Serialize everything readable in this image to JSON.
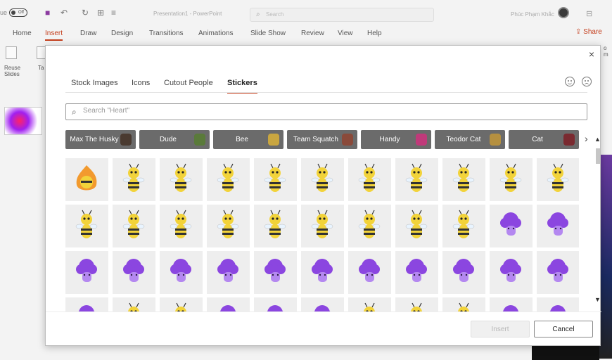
{
  "titlebar": {
    "autosave_label": "ue",
    "autosave_state": "Off",
    "document_title": "Presentation1 - PowerPoint",
    "search_placeholder": "Search",
    "user_name": "Phúc Phạm Khắc"
  },
  "ribbon": {
    "tabs": [
      "Home",
      "Insert",
      "Draw",
      "Design",
      "Transitions",
      "Animations",
      "Slide Show",
      "Review",
      "View",
      "Help"
    ],
    "active_tab": "Insert",
    "share_label": "Share",
    "reuse_label_1": "Reuse",
    "reuse_label_2": "Slides",
    "partial_group_label": "Ta",
    "partial_right_label_1": "ο",
    "partial_right_label_2": "m"
  },
  "dialog": {
    "close_symbol": "×",
    "tabs": [
      {
        "label": "Stock Images"
      },
      {
        "label": "Icons"
      },
      {
        "label": "Cutout People"
      },
      {
        "label": "Stickers"
      }
    ],
    "active_tab": "Stickers",
    "search": {
      "placeholder": "Search \"Heart\""
    },
    "categories": [
      "Max The Husky",
      "Dude",
      "Bee",
      "Team Squatch",
      "Handy",
      "Teodor Cat",
      "Cat"
    ],
    "category_colors": [
      "#4a3a30",
      "#5a7a3a",
      "#c9a640",
      "#8a4a3a",
      "#c03a7a",
      "#b59040",
      "#7a2a30"
    ],
    "stickers": {
      "rows": [
        [
          "bee-fire",
          "bee",
          "bee",
          "bee",
          "bee",
          "bee",
          "bee",
          "bee",
          "bee",
          "bee",
          "bee"
        ],
        [
          "bee",
          "bee",
          "bee",
          "bee",
          "bee",
          "bee",
          "bee",
          "bee",
          "bee",
          "purple",
          "purple"
        ],
        [
          "purple",
          "purple",
          "purple",
          "purple",
          "purple",
          "purple",
          "purple",
          "purple",
          "purple",
          "purple",
          "purple"
        ],
        [
          "purple",
          "bee",
          "bee",
          "purple",
          "purple",
          "purple",
          "bee",
          "bee",
          "bee",
          "purple",
          "purple"
        ]
      ]
    },
    "buttons": {
      "insert": "Insert",
      "cancel": "Cancel"
    }
  },
  "colors": {
    "accent": "#c43e1c",
    "bee_yellow": "#f2d33a",
    "sticker_purple": "#8b46e0"
  }
}
